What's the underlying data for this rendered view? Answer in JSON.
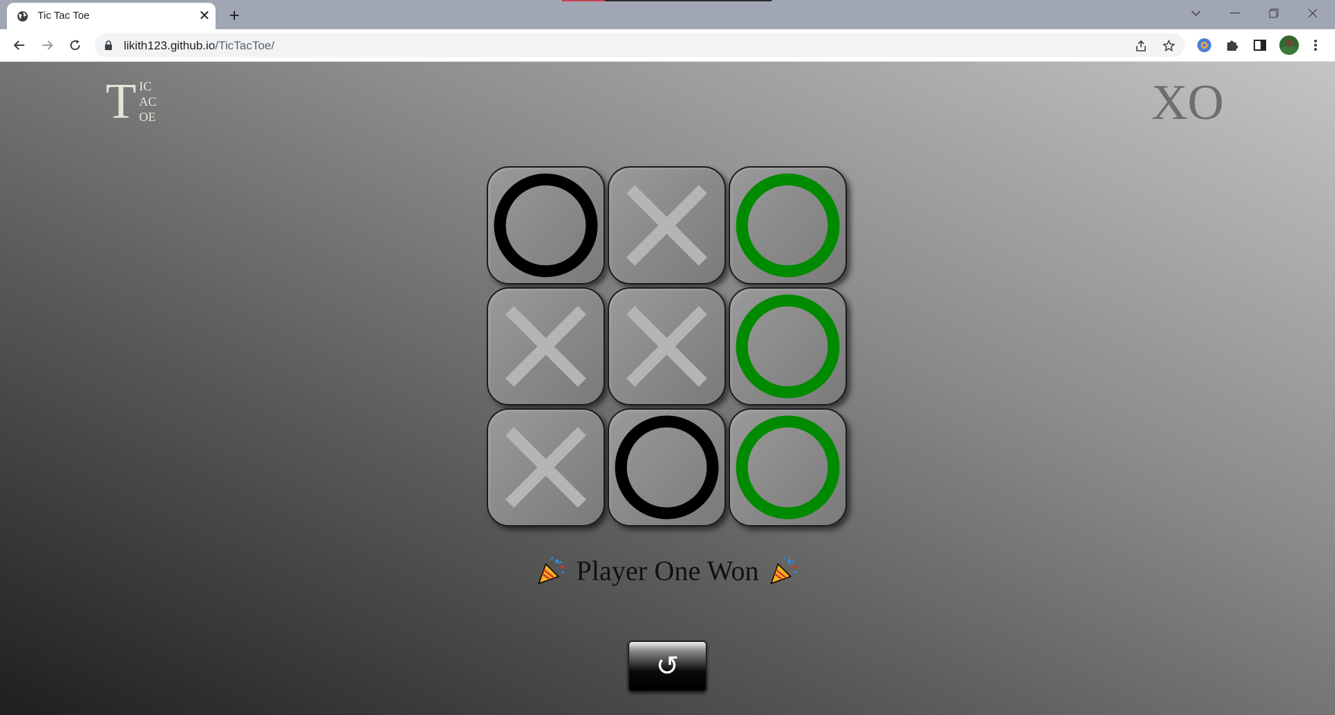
{
  "browser": {
    "tab_title": "Tic Tac Toe",
    "tab_close": "✕",
    "new_tab": "+",
    "url_host": "likith123.github.io",
    "url_path": "/TicTacToe/"
  },
  "header": {
    "logo_big": "T",
    "logo_lines": [
      "IC",
      "AC",
      "OE"
    ],
    "brand": "XO"
  },
  "board": {
    "cells": [
      {
        "mark": "O",
        "color": "#000000"
      },
      {
        "mark": "X",
        "color": "#b5b5b5"
      },
      {
        "mark": "O",
        "color": "#008a00"
      },
      {
        "mark": "X",
        "color": "#b5b5b5"
      },
      {
        "mark": "X",
        "color": "#b5b5b5"
      },
      {
        "mark": "O",
        "color": "#008a00"
      },
      {
        "mark": "X",
        "color": "#b5b5b5"
      },
      {
        "mark": "O",
        "color": "#000000"
      },
      {
        "mark": "O",
        "color": "#008a00"
      }
    ]
  },
  "status": {
    "text": "Player One Won",
    "icon": "party-popper-icon"
  },
  "reset": {
    "glyph": "↺",
    "icon": "restart-icon"
  },
  "colors": {
    "win": "#008a00",
    "o_default": "#000000",
    "x_default": "#b5b5b5"
  }
}
